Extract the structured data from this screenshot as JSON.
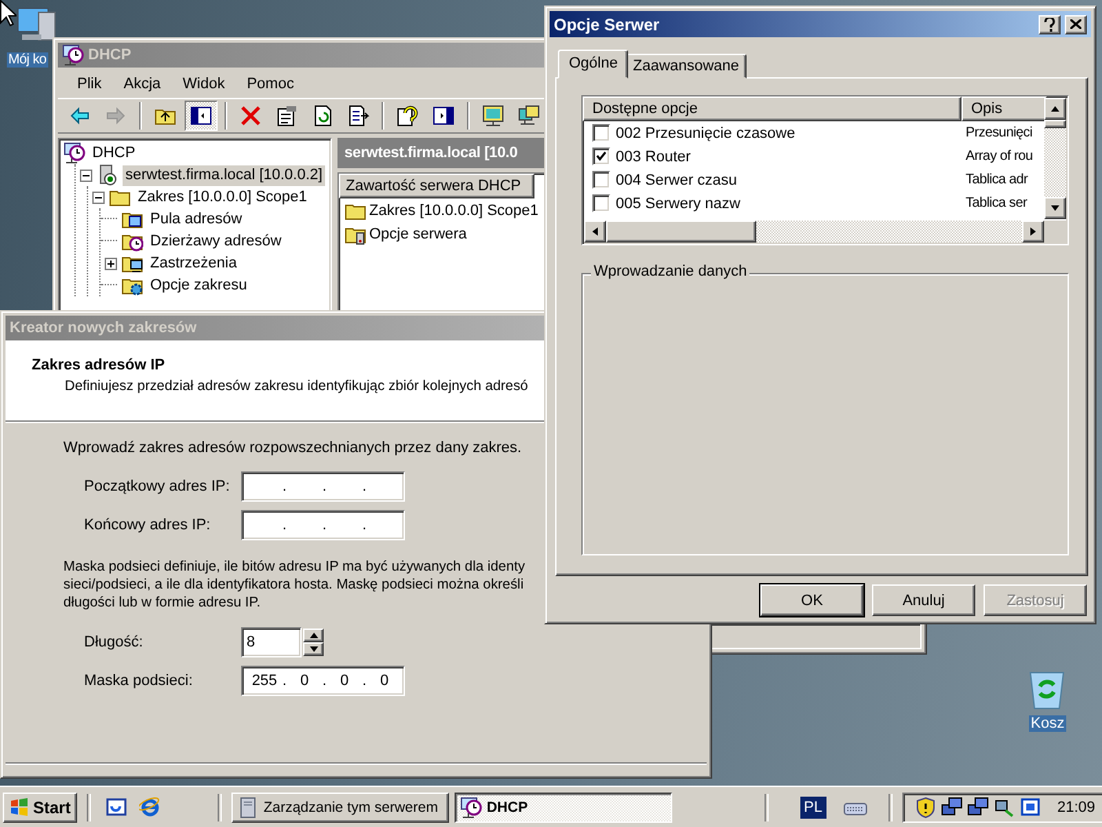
{
  "desktop_icons": [
    {
      "kind": "computer",
      "label": "Mój ko"
    },
    {
      "kind": "recycle_bin",
      "label": "Kosz"
    }
  ],
  "dhcp_window": {
    "title": "DHCP",
    "menu": [
      "Plik",
      "Akcja",
      "Widok",
      "Pomoc"
    ],
    "toolbar": [
      {
        "disabled": false,
        "pressed": false
      },
      {
        "disabled": true,
        "pressed": false
      },
      {
        "disabled": false,
        "pressed": false
      },
      {
        "disabled": false,
        "pressed": true
      },
      {
        "disabled": false,
        "pressed": false
      },
      {
        "disabled": false,
        "pressed": false
      },
      {
        "disabled": false,
        "pressed": false
      },
      {
        "disabled": false,
        "pressed": false
      },
      {
        "disabled": false,
        "pressed": false
      },
      {
        "disabled": false,
        "pressed": false
      },
      {
        "disabled": false,
        "pressed": false
      },
      {
        "disabled": false,
        "pressed": false
      }
    ],
    "tree": [
      {
        "kind": "dhcp",
        "label": "DHCP",
        "selected": false,
        "children": [
          {
            "kind": "server",
            "label": "serwtest.firma.local [10.0.0.2]",
            "selected": true,
            "expanded": true,
            "children": [
              {
                "kind": "scope",
                "label": "Zakres [10.0.0.0] Scope1",
                "selected": false,
                "expanded": true,
                "children": [
                  {
                    "kind": "pool",
                    "label": "Pula adresów",
                    "selected": false
                  },
                  {
                    "kind": "leases",
                    "label": "Dzierżawy adresów",
                    "selected": false
                  },
                  {
                    "kind": "reservations",
                    "label": "Zastrzeżenia",
                    "selected": false,
                    "expanded": false
                  },
                  {
                    "kind": "scope_options",
                    "label": "Opcje zakresu",
                    "selected": false
                  }
                ]
              }
            ]
          }
        ]
      }
    ],
    "content_title": "serwtest.firma.local [10.0",
    "content_column": "Zawartość serwera DHCP",
    "content_items": [
      {
        "kind": "scope",
        "label": "Zakres [10.0.0.0] Scope1"
      },
      {
        "kind": "server_options",
        "label": "Opcje serwera"
      }
    ]
  },
  "wizard": {
    "title": "Kreator nowych zakresów",
    "heading": "Zakres adresów IP",
    "subheading": "Definiujesz przedział adresów zakresu identyfikując zbiór kolejnych adresó",
    "intro": "Wprowadź zakres adresów rozpowszechnianych przez dany zakres.",
    "range_fields": [
      {
        "kind": "ip",
        "label": "Początkowy adres IP:",
        "value": ". . ."
      },
      {
        "kind": "ip",
        "label": "Końcowy adres IP:",
        "value": ". . ."
      }
    ],
    "mask_description_lines": [
      "Maska podsieci definiuje, ile bitów adresu IP ma być używanych dla identy",
      "sieci/podsieci, a ile dla identyfikatora hosta. Maskę podsieci można określi",
      "długości lub w formie adresu IP."
    ],
    "mask_fields": [
      {
        "kind": "spin",
        "label": "Długość:",
        "value": "8"
      },
      {
        "kind": "ip",
        "label": "Maska podsieci:",
        "value": "255 . 0 . 0 . 0"
      }
    ]
  },
  "options_dialog": {
    "title": "Opcje Serwer",
    "tabs": [
      {
        "label": "Ogólne",
        "selected": true
      },
      {
        "label": "Zaawansowane",
        "selected": false
      }
    ],
    "columns": [
      "Dostępne opcje",
      "Opis"
    ],
    "options": [
      {
        "name": "002 Przesunięcie czasowe",
        "description": "Przesunięci",
        "checked": false
      },
      {
        "name": "003 Router",
        "description": "Array of rou",
        "checked": true
      },
      {
        "name": "004 Serwer czasu",
        "description": "Tablica adr",
        "checked": false
      },
      {
        "name": "005 Serwery nazw",
        "description": "Tablica ser",
        "checked": false
      }
    ],
    "group_label": "Wprowadzanie danych",
    "buttons": [
      {
        "label": "OK",
        "default": true,
        "disabled": false
      },
      {
        "label": "Anuluj",
        "default": false,
        "disabled": false
      },
      {
        "label": "Zastosuj",
        "default": false,
        "disabled": true
      }
    ]
  },
  "taskbar": {
    "start": "Start",
    "tasks": [
      {
        "kind": "server_manager",
        "label": "Zarządzanie tym serwerem",
        "selected": false
      },
      {
        "kind": "dhcp",
        "label": "DHCP",
        "selected": true
      }
    ],
    "language": "PL",
    "clock": "21:09"
  }
}
